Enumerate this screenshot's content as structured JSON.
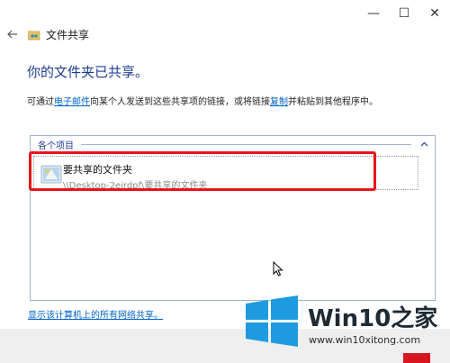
{
  "window": {
    "title": "文件共享",
    "controls": {
      "minimize": "—",
      "maximize": "☐",
      "close": "✕"
    }
  },
  "main": {
    "heading": "你的文件夹已共享。",
    "description": {
      "prefix": "可通过",
      "link1": "电子邮件",
      "middle": "向某个人发送到这些共享项的链接，或将链接",
      "link2": "复制",
      "suffix": "并粘贴到其他程序中。"
    },
    "group_header": "各个项目",
    "items": [
      {
        "name": "要共享的文件夹",
        "path": "\\\\Desktop-2ejrdpf\\要共享的文件夹"
      }
    ],
    "show_all_link": "显示该计算机上的所有网络共享。"
  },
  "watermark": {
    "brand": "Win10",
    "brand_cn": "之家",
    "url": "www.win10xitong.com",
    "colors": {
      "logo_blue": "#1e9be0",
      "text": "#1e2a34"
    }
  },
  "colors": {
    "heading": "#1e3c96",
    "link": "#0063c5",
    "highlight": "#e8151b"
  }
}
